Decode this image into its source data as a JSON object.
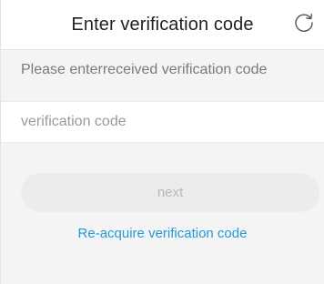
{
  "header": {
    "title": "Enter verification code",
    "refresh_icon": "refresh-icon"
  },
  "form": {
    "instruction": "Please enterreceived verification code",
    "code_placeholder": "verification code",
    "code_value": "",
    "next_label": "next",
    "reacquire_label": "Re-acquire verification code"
  },
  "colors": {
    "page_background": "#f4f4f4",
    "link": "#2199dd",
    "disabled_button_background": "#ececec",
    "disabled_button_text": "#b8b8b8"
  }
}
